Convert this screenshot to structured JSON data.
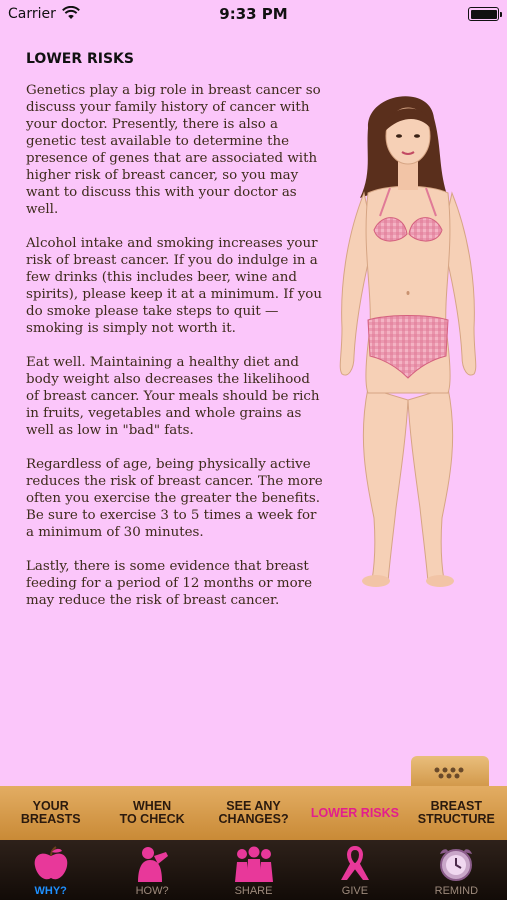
{
  "status_bar": {
    "carrier": "Carrier",
    "time": "9:33 PM"
  },
  "content": {
    "heading": "LOWER RISKS",
    "paragraphs": [
      "Genetics play a big role in breast cancer so discuss your family history of cancer with your doctor. Presently, there is also a genetic test available to determine the presence of genes that are associated with higher risk of breast cancer, so you may want to discuss this with your doctor as well.",
      "Alcohol intake and smoking increases your risk of breast cancer. If you do indulge in a few drinks (this includes beer, wine and spirits), please keep it at a minimum. If you do smoke please take steps to quit — smoking is simply not worth it.",
      "Eat well. Maintaining a healthy diet and body weight also decreases the likelihood of breast cancer. Your meals should be rich in fruits, vegetables and whole grains as well as low in \"bad\" fats.",
      "Regardless of age, being physically active reduces the risk of breast cancer. The more often you exercise the greater the benefits. Be sure to exercise 3 to 5 times a week for a minimum of 30 minutes.",
      "Lastly, there is some evidence that breast feeding for a period of 12 months or more may reduce the risk of breast cancer."
    ]
  },
  "subtabs": [
    {
      "label": "YOUR\nBREASTS"
    },
    {
      "label": "WHEN\nTO CHECK"
    },
    {
      "label": "SEE ANY\nCHANGES?"
    },
    {
      "label": "LOWER RISKS"
    },
    {
      "label": "BREAST\nSTRUCTURE"
    }
  ],
  "subtab_active_index": 3,
  "tabs": [
    {
      "label": "WHY?",
      "icon": "apple-icon"
    },
    {
      "label": "HOW?",
      "icon": "self-exam-icon"
    },
    {
      "label": "SHARE",
      "icon": "people-icon"
    },
    {
      "label": "GIVE",
      "icon": "pink-ribbon-icon"
    },
    {
      "label": "REMIND",
      "icon": "alarm-clock-icon"
    }
  ],
  "tab_active_index": 0,
  "colors": {
    "background": "#fbc6fa",
    "accent": "#e31e8d",
    "active_tab": "#1e90ff"
  }
}
